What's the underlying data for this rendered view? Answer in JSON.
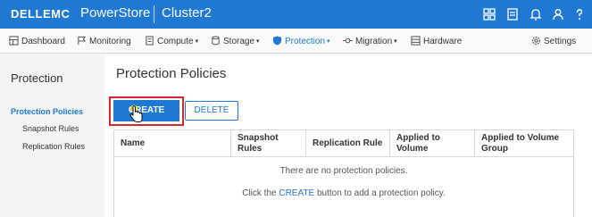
{
  "header": {
    "brand": "DELLEMC",
    "product": "PowerStore",
    "cluster": "Cluster2",
    "icons": [
      "tasks-icon",
      "list-icon",
      "bell-icon",
      "user-icon",
      "help-icon"
    ]
  },
  "nav": {
    "items": [
      {
        "label": "Dashboard",
        "icon": "dashboard-icon",
        "caret": ""
      },
      {
        "label": "Monitoring",
        "icon": "flag-icon",
        "caret": ""
      },
      {
        "label": "Compute",
        "icon": "compute-icon",
        "caret": "▾"
      },
      {
        "label": "Storage",
        "icon": "storage-icon",
        "caret": "▾"
      },
      {
        "label": "Protection",
        "icon": "shield-icon",
        "caret": "▾"
      },
      {
        "label": "Migration",
        "icon": "migration-icon",
        "caret": "▾"
      },
      {
        "label": "Hardware",
        "icon": "hardware-icon",
        "caret": ""
      }
    ],
    "settings": "Settings"
  },
  "sidebar": {
    "title": "Protection",
    "items": [
      {
        "label": "Protection Policies"
      },
      {
        "label": "Snapshot Rules"
      },
      {
        "label": "Replication Rules"
      }
    ]
  },
  "main": {
    "title": "Protection Policies",
    "create_label": "CREATE",
    "delete_label": "DELETE",
    "columns": [
      {
        "line1": "Name",
        "line2": ""
      },
      {
        "line1": "Snapshot",
        "line2": "Rules"
      },
      {
        "line1": "Replication Rule",
        "line2": ""
      },
      {
        "line1": "Applied to",
        "line2": "Volume"
      },
      {
        "line1": "Applied to Volume",
        "line2": "Group"
      }
    ],
    "empty_message": "There are no protection policies.",
    "hint_prefix": "Click the",
    "hint_link": "CREATE",
    "hint_suffix": "button to add a protection policy."
  },
  "colors": {
    "accent": "#1f78d1",
    "highlight": "#d9262c"
  }
}
